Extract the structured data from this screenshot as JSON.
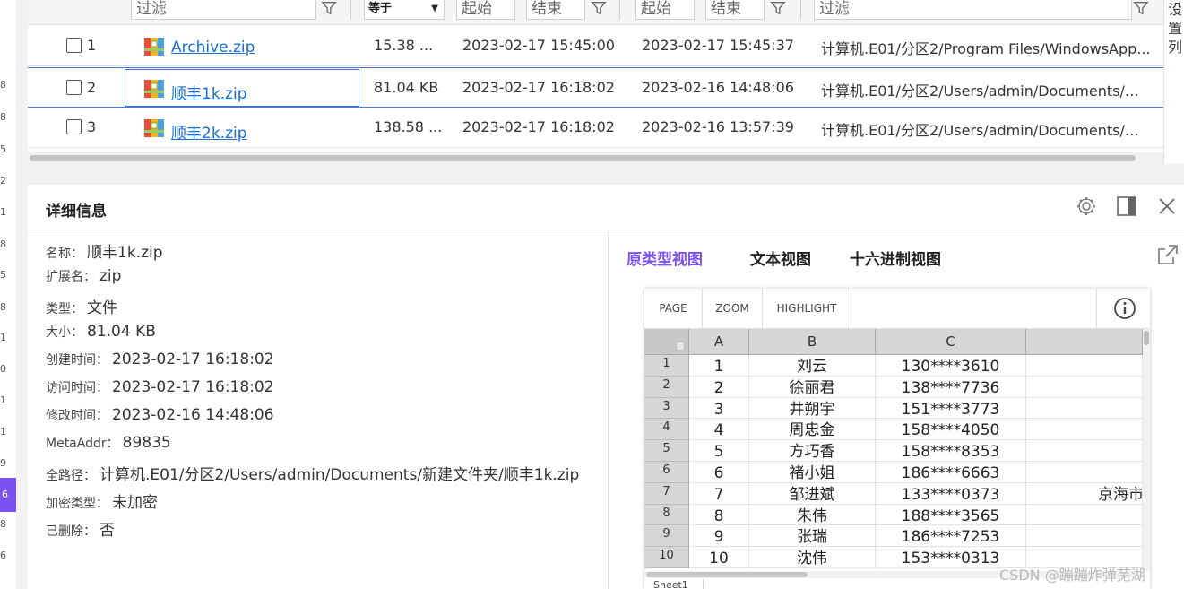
{
  "gutter_numbers": [
    "8",
    "8",
    "5",
    "2",
    "1",
    "8",
    "5",
    "8",
    "1",
    "0",
    "1",
    "1",
    "9",
    "6",
    "8",
    "6"
  ],
  "filters": {
    "name_filter": "过滤",
    "size_op": "等于",
    "created_start": "起始",
    "created_end": "结束",
    "modified_start": "起始",
    "modified_end": "结束",
    "path_filter": "过滤"
  },
  "settings_column_label": [
    "设",
    "置",
    "列"
  ],
  "files": [
    {
      "index": "1",
      "name": "Archive.zip",
      "size": "15.38 ...",
      "created": "2023-02-17 15:45:00",
      "modified": "2023-02-17 15:45:37",
      "path": "计算机.E01/分区2/Program Files/WindowsApp..."
    },
    {
      "index": "2",
      "name": "顺丰1k.zip",
      "size": "81.04 KB",
      "created": "2023-02-17 16:18:02",
      "modified": "2023-02-16 14:48:06",
      "path": "计算机.E01/分区2/Users/admin/Documents/新..."
    },
    {
      "index": "3",
      "name": "顺丰2k.zip",
      "size": "138.58 ...",
      "created": "2023-02-17 16:18:02",
      "modified": "2023-02-16 13:57:39",
      "path": "计算机.E01/分区2/Users/admin/Documents/新..."
    }
  ],
  "detail": {
    "title": "详细信息",
    "props": [
      {
        "k": "名称：",
        "v": "顺丰1k.zip"
      },
      {
        "k": "扩展名：",
        "v": "zip"
      },
      {
        "k": "类型：",
        "v": "文件"
      },
      {
        "k": "大小：",
        "v": "81.04 KB"
      },
      {
        "k": "创建时间：",
        "v": "2023-02-17 16:18:02"
      },
      {
        "k": "访问时间：",
        "v": "2023-02-17 16:18:02"
      },
      {
        "k": "修改时间：",
        "v": "2023-02-16 14:48:06"
      },
      {
        "k": "MetaAddr：",
        "v": "89835"
      },
      {
        "k": "全路径：",
        "v": "计算机.E01/分区2/Users/admin/Documents/新建文件夹/顺丰1k.zip"
      },
      {
        "k": "加密类型：",
        "v": "未加密"
      },
      {
        "k": "已删除：",
        "v": "否"
      }
    ],
    "tabs": [
      "原类型视图",
      "文本视图",
      "十六进制视图"
    ],
    "active_tab": 0
  },
  "preview": {
    "toolbar": [
      "PAGE",
      "ZOOM",
      "HIGHLIGHT"
    ],
    "columns": [
      "A",
      "B",
      "C",
      ""
    ],
    "rows": [
      {
        "r": "1",
        "a": "1",
        "b": "刘云",
        "c": "130****3610",
        "d": ""
      },
      {
        "r": "2",
        "a": "2",
        "b": "徐丽君",
        "c": "138****7736",
        "d": ""
      },
      {
        "r": "3",
        "a": "3",
        "b": "井朔宇",
        "c": "151****3773",
        "d": ""
      },
      {
        "r": "4",
        "a": "4",
        "b": "周忠金",
        "c": "158****4050",
        "d": ""
      },
      {
        "r": "5",
        "a": "5",
        "b": "方巧香",
        "c": "158****8353",
        "d": ""
      },
      {
        "r": "6",
        "a": "6",
        "b": "褚小姐",
        "c": "186****6663",
        "d": ""
      },
      {
        "r": "7",
        "a": "7",
        "b": "邹进斌",
        "c": "133****0373",
        "d": "京海市"
      },
      {
        "r": "8",
        "a": "8",
        "b": "朱伟",
        "c": "188****3565",
        "d": ""
      },
      {
        "r": "9",
        "a": "9",
        "b": "张瑞",
        "c": "186****7253",
        "d": ""
      },
      {
        "r": "10",
        "a": "10",
        "b": "沈伟",
        "c": "153****0313",
        "d": ""
      }
    ],
    "sheet_tab": "Sheet1"
  },
  "watermark": "CSDN @蹦蹦炸弹芜湖",
  "colors": {
    "accent": "#7b52f0",
    "link": "#1a6fd1",
    "selection": "#3d6fd6"
  }
}
